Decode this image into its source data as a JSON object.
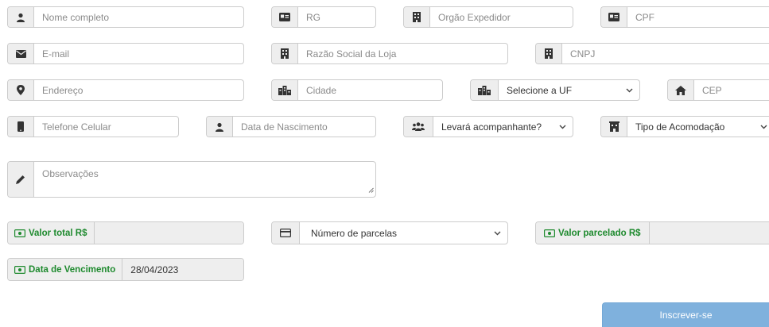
{
  "fields": {
    "nome_completo": {
      "placeholder": "Nome completo",
      "icon": "user-icon"
    },
    "rg": {
      "placeholder": "RG",
      "icon": "id-card-icon"
    },
    "orgao_expedidor": {
      "placeholder": "Orgão Expedidor",
      "icon": "building-icon"
    },
    "cpf": {
      "placeholder": "CPF",
      "icon": "id-card-icon"
    },
    "email": {
      "placeholder": "E-mail",
      "icon": "envelope-icon"
    },
    "razao_social": {
      "placeholder": "Razão Social da Loja",
      "icon": "building-icon"
    },
    "cnpj": {
      "placeholder": "CNPJ",
      "icon": "building-icon"
    },
    "endereco": {
      "placeholder": "Endereço",
      "icon": "map-marker-icon"
    },
    "cidade": {
      "placeholder": "Cidade",
      "icon": "city-icon"
    },
    "uf": {
      "selected": "Selecione a UF",
      "icon": "city-icon"
    },
    "cep": {
      "placeholder": "CEP",
      "icon": "home-icon"
    },
    "telefone": {
      "placeholder": "Telefone Celular",
      "icon": "mobile-phone-icon"
    },
    "data_nascimento": {
      "placeholder": "Data de Nascimento",
      "icon": "user-icon"
    },
    "acompanhante": {
      "selected": "Levará acompanhante?",
      "icon": "users-icon"
    },
    "acomodacao": {
      "selected": "Tipo de Acomodação",
      "icon": "hotel-icon"
    },
    "observacoes": {
      "placeholder": "Observações",
      "icon": "pencil-icon"
    },
    "valor_total": {
      "label": "Valor total R$",
      "value": "",
      "icon": "money-icon"
    },
    "parcelas": {
      "selected": "Número de parcelas",
      "icon": "credit-card-icon"
    },
    "valor_parcelado": {
      "label": "Valor parcelado R$",
      "value": "",
      "icon": "money-icon"
    },
    "data_vencimento": {
      "label": "Data de Vencimento",
      "value": "28/04/2023",
      "icon": "money-icon"
    }
  },
  "submit": {
    "label": "Inscrever-se"
  },
  "colors": {
    "money_label": "#1e8a2e",
    "button_bg": "#7fb1dd",
    "addon_bg": "#eeeeee",
    "border": "#cccccc"
  }
}
